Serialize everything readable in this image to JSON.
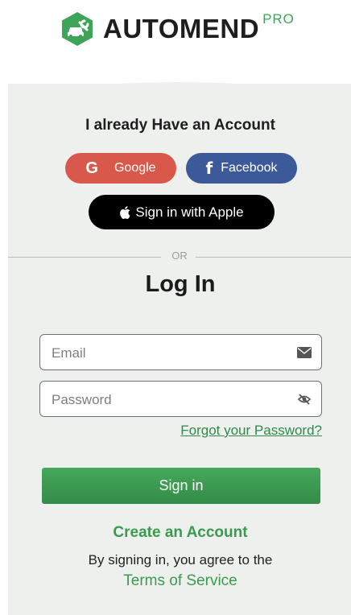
{
  "brand": {
    "name": "AUTOMEND",
    "suffix": "PRO",
    "accent_color": "#3fa45a",
    "logo_icon": "hexagon-car-wrench-icon"
  },
  "social": {
    "heading": "I already Have an Account",
    "google_label": "Google",
    "google_glyph": "G",
    "facebook_label": "Facebook",
    "facebook_glyph": "f",
    "apple_label": "Sign in with Apple",
    "google_color": "#d8584b",
    "facebook_color": "#3c5a9a",
    "apple_color": "#000000"
  },
  "divider": {
    "label": "OR"
  },
  "login": {
    "title": "Log In",
    "email_placeholder": "Email",
    "email_value": "",
    "password_placeholder": "Password",
    "password_value": "",
    "forgot_label": "Forgot your Password?",
    "signin_label": "Sign in",
    "button_color": "#3a9b4f"
  },
  "footer": {
    "create_label": "Create an Account",
    "agree_text": "By signing in, you agree to the",
    "terms_label": "Terms of Service"
  },
  "icons": {
    "email": "envelope-icon",
    "password": "eye-slash-icon",
    "apple": "apple-icon",
    "google": "google-icon",
    "facebook": "facebook-icon"
  }
}
